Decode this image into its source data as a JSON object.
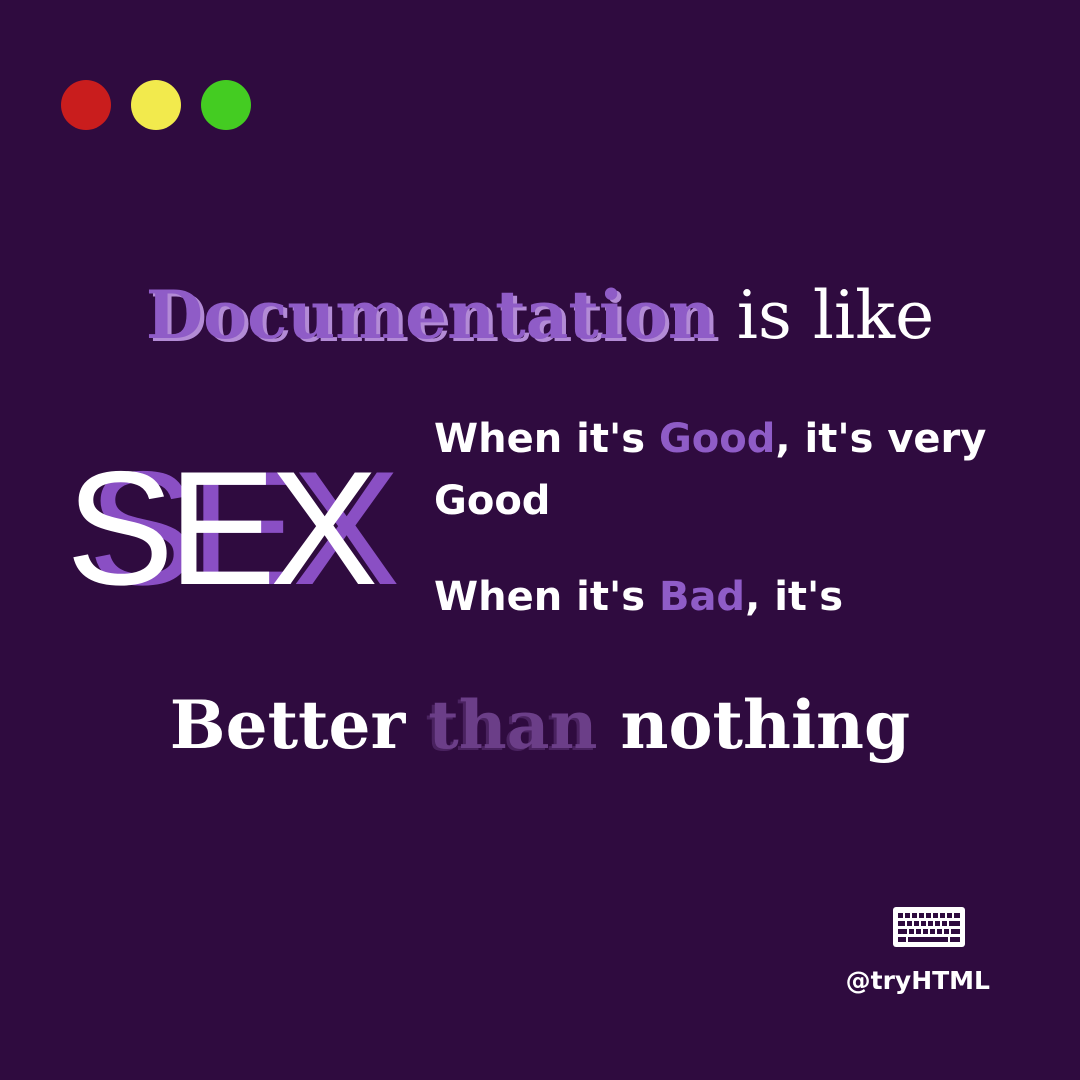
{
  "colors": {
    "background": "#2f0b3f",
    "accent": "#8f5cc7",
    "window_red": "#c91d1d",
    "window_yellow": "#f2ea4d",
    "window_green": "#44cc22"
  },
  "headline": {
    "highlight": "Documentation",
    "rest": " is like"
  },
  "big_word": "SEX",
  "good_line": {
    "prefix": "When it's ",
    "highlight": "Good",
    "suffix": ", it's very Good"
  },
  "bad_line": {
    "prefix": "When it's ",
    "highlight": "Bad",
    "suffix": ", it's"
  },
  "bottom_line": {
    "first": "Better ",
    "middle": "than",
    "last": " nothing"
  },
  "footer": {
    "icon": "keyboard-icon",
    "handle": "@tryHTML"
  }
}
